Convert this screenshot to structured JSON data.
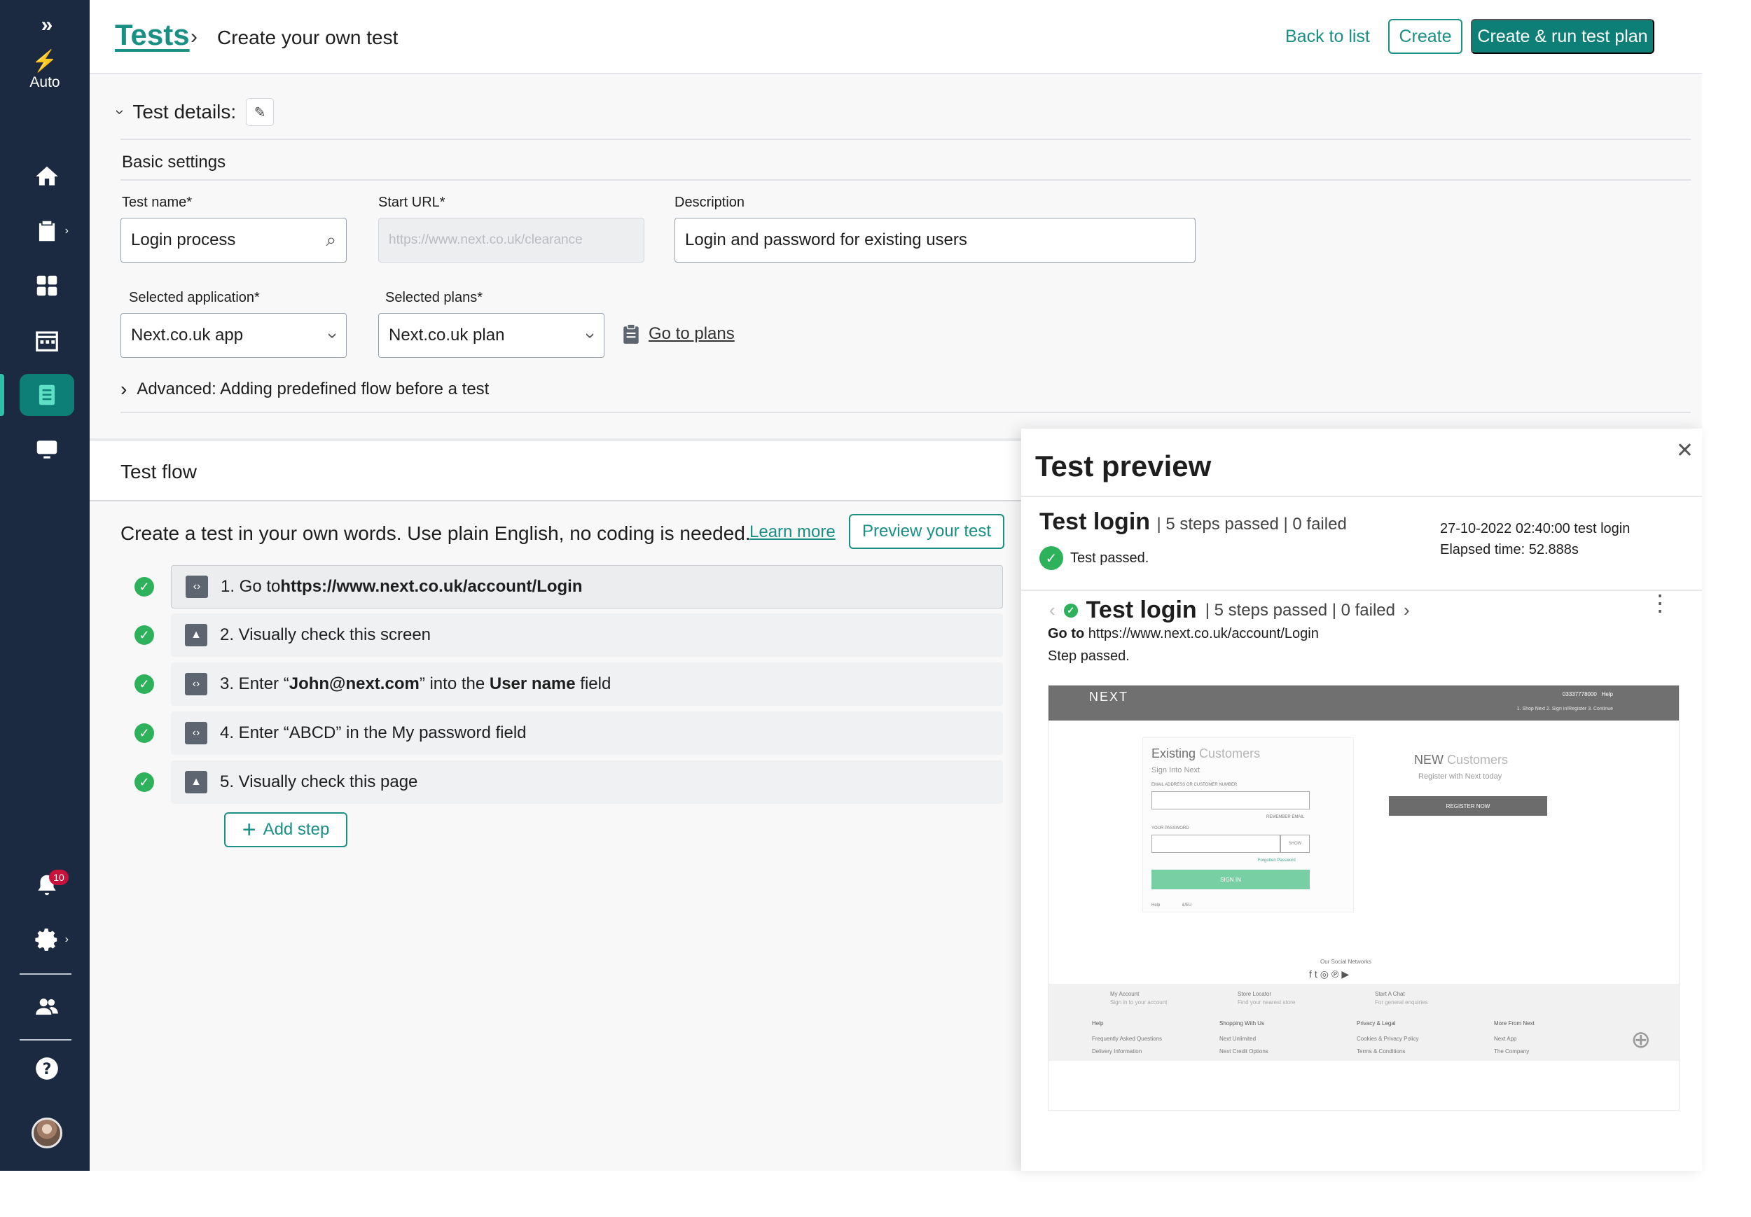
{
  "sidebar": {
    "expand_icon": "double-chevron-right",
    "logo_label": "Auto",
    "notification_count": "10"
  },
  "header": {
    "breadcrumb_root": "Tests",
    "breadcrumb_current": "Create your own test",
    "back_label": "Back to list",
    "create_label": "Create",
    "create_run_label": "Create & run test plan"
  },
  "details": {
    "section_title": "Test details:",
    "basic_settings": "Basic settings",
    "test_name_label": "Test name*",
    "test_name_value": "Login process",
    "start_url_label": "Start URL*",
    "start_url_placeholder": "https://www.next.co.uk/clearance",
    "description_label": "Description",
    "description_value": "Login and password for existing users",
    "app_label": "Selected application*",
    "app_value": "Next.co.uk app",
    "plans_label": "Selected plans*",
    "plans_value": "Next.co.uk plan",
    "go_to_plans": "Go to plans",
    "advanced": "Advanced: Adding predefined flow before a test"
  },
  "flow": {
    "title": "Test flow",
    "intro": "Create a test in your own words. Use plain English, no coding is needed.",
    "learn_more": "Learn more",
    "preview_btn": "Preview your test",
    "add_step": "Add step",
    "steps": [
      {
        "pre": "1. Go to ",
        "bold": "https://www.next.co.uk/account/Login",
        "post": "",
        "icon": "code"
      },
      {
        "pre": "2. Visually check this screen",
        "bold": "",
        "post": "",
        "icon": "image"
      },
      {
        "pre": "3. Enter “",
        "bold": "John@next.com",
        "mid": "” into the ",
        "bold2": "User name",
        "post": " field",
        "icon": "code"
      },
      {
        "pre": "4. Enter “ABCD” in the My password field",
        "bold": "",
        "post": "",
        "icon": "code"
      },
      {
        "pre": "5. Visually check this page",
        "bold": "",
        "post": "",
        "icon": "image"
      }
    ]
  },
  "preview": {
    "title": "Test preview",
    "test_name": "Test login",
    "summary": "| 5 steps passed | 0 failed",
    "date_line": "27-10-2022 02:40:00  test login",
    "elapsed": "Elapsed time: 52.888s",
    "passed": "Test passed.",
    "step_name": "Test login",
    "step_summary": "| 5 steps passed | 0 failed",
    "goto_bold": "Go to",
    "goto_url": "https://www.next.co.uk/account/Login",
    "step_passed": "Step passed.",
    "shot": {
      "brand": "NEXT",
      "phone": "03337778000",
      "help": "Help",
      "checkout": "1. Shop Next   2. Sign in/Register   3. Continue",
      "existing": "Existing",
      "customers": "Customers",
      "sign_into": "Sign Into Next",
      "email_label": "EMAIL ADDRESS OR CUSTOMER NUMBER",
      "remember": "REMEMBER EMAIL",
      "password_label": "YOUR PASSWORD",
      "show": "SHOW",
      "forgotten": "Forgotten Password",
      "sign_in": "SIGN IN",
      "help2": "Help",
      "en": "£/EU",
      "new_label": "NEW",
      "new_customers": "Customers",
      "register_with": "Register with Next today",
      "register_now": "REGISTER NOW",
      "social": "Our Social Networks",
      "my_account": "My Account",
      "my_account_sub": "Sign in to your account",
      "store_locator": "Store Locator",
      "store_sub": "Find your nearest store",
      "start_chat": "Start A Chat",
      "chat_sub": "For general enquiries",
      "help_col": "Help",
      "faq": "Frequently Asked Questions",
      "delivery": "Delivery Information",
      "shopping": "Shopping With Us",
      "unlimited": "Next Unlimited",
      "credit": "Next Credit Options",
      "privacy": "Privacy & Legal",
      "cookies": "Cookies & Privacy Policy",
      "terms": "Terms & Conditions",
      "more": "More From Next",
      "app": "Next App",
      "company": "The Company"
    }
  },
  "colors": {
    "sidebar": "#1b2a40",
    "accent": "#0e7f76",
    "success": "#2eb15b",
    "badge": "#c9123b"
  }
}
